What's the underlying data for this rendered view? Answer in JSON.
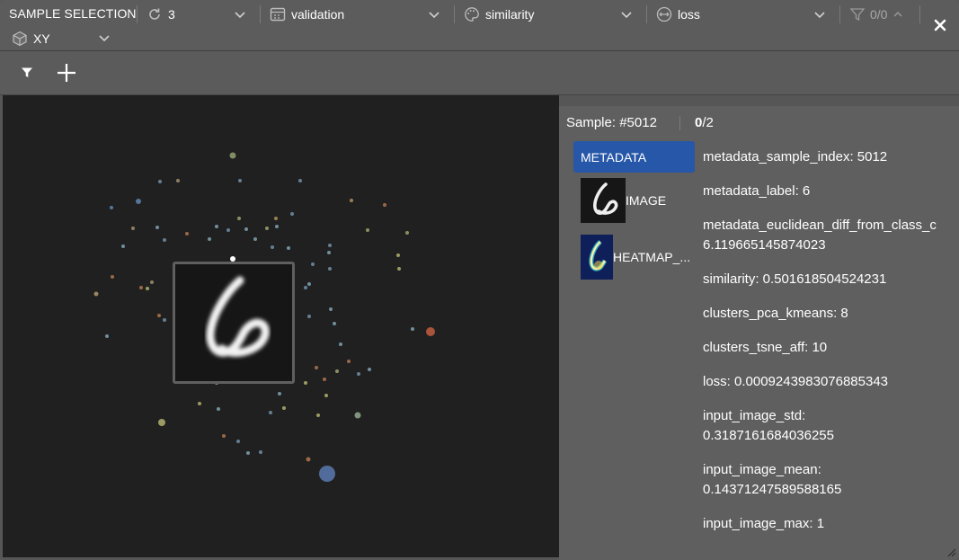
{
  "window": {
    "title": "SAMPLE SELECTION"
  },
  "toolbar": {
    "refresh_value": "3",
    "split_value": "validation",
    "color_value": "similarity",
    "size_value": "loss",
    "filter_count": "0/0",
    "view_value": "XY"
  },
  "plot": {
    "background": "#202020"
  },
  "panel": {
    "sample_label": "Sample: #5012",
    "counter_current": "0",
    "counter_total": "/2",
    "tabs": [
      {
        "label": "METADATA"
      },
      {
        "label": "IMAGE"
      },
      {
        "label": "HEATMAP_..."
      }
    ],
    "metadata": [
      {
        "text": "metadata_sample_index: 5012"
      },
      {
        "text": "metadata_label: 6"
      },
      {
        "text": "metadata_euclidean_diff_from_class_c"
      },
      {
        "text": "6.119665145874023"
      },
      {
        "text": "similarity: 0.501618504524231"
      },
      {
        "text": "clusters_pca_kmeans: 8"
      },
      {
        "text": "clusters_tsne_aff: 10"
      },
      {
        "text": "loss: 0.0009243983076885343"
      },
      {
        "text": "input_image_std:"
      },
      {
        "text": "0.3187161684036255"
      },
      {
        "text": "input_image_mean:"
      },
      {
        "text": "0.14371247589588165"
      },
      {
        "text": "input_image_max: 1"
      }
    ]
  },
  "colors": {
    "accent": "#2757a8",
    "toolbar_bg": "#5c5c5c",
    "panel_bg": "#5f5f5f"
  }
}
